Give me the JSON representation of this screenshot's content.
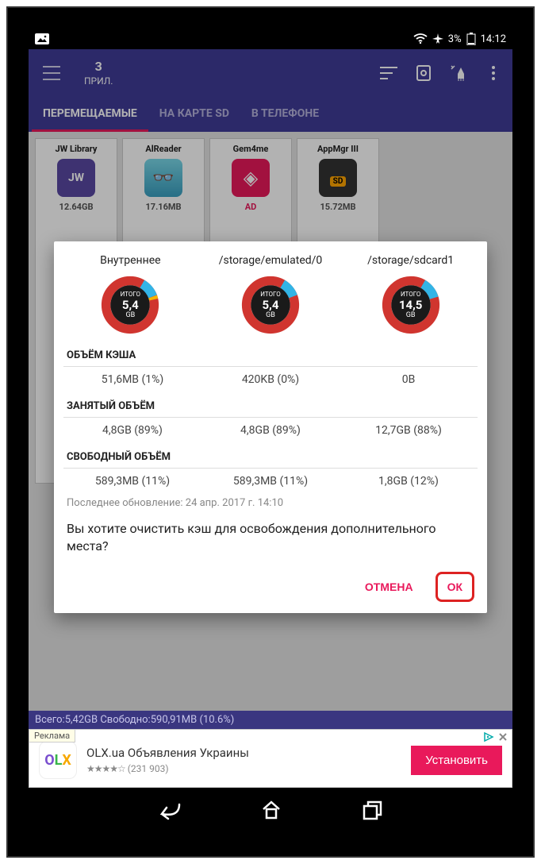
{
  "status": {
    "battery": "3%",
    "time": "14:12"
  },
  "header": {
    "count": "3",
    "count_label": "ПРИЛ."
  },
  "tabs": {
    "movable": "ПЕРЕМЕЩАЕМЫЕ",
    "onsd": "НА КАРТЕ SD",
    "phone": "В ТЕЛЕФОНЕ"
  },
  "apps": [
    {
      "name": "JW Library",
      "size": "12.64GB",
      "icon_bg": "#5A48A3",
      "icon_text": "JW"
    },
    {
      "name": "AlReader",
      "size": "17.16MB",
      "icon_bg": "#6ed0e0",
      "icon_text": "👓"
    },
    {
      "name": "Gem4me",
      "size": "AD",
      "icon_bg": "#E9195B",
      "icon_text": "◇",
      "is_ad": true
    },
    {
      "name": "AppMgr III",
      "size": "15.72MB",
      "icon_bg": "#333",
      "icon_text": "SD"
    }
  ],
  "dialog": {
    "cols": [
      {
        "label": "Внутреннее",
        "total_label": "ИТОГО",
        "value": "5,4",
        "unit": "GB"
      },
      {
        "label": "/storage/emulated/0",
        "total_label": "ИТОГО",
        "value": "5,4",
        "unit": "GB"
      },
      {
        "label": "/storage/sdcard1",
        "total_label": "ИТОГО",
        "value": "14,5",
        "unit": "GB"
      }
    ],
    "sections": {
      "cache": {
        "title": "ОБЪЁМ КЭША",
        "v1": "51,6MB (1%)",
        "v2": "420KB (0%)",
        "v3": "0B"
      },
      "used": {
        "title": "ЗАНЯТЫЙ ОБЪЁМ",
        "v1": "4,8GB (89%)",
        "v2": "4,8GB (89%)",
        "v3": "12,7GB (88%)"
      },
      "free": {
        "title": "СВОБОДНЫЙ ОБЪЁМ",
        "v1": "589,3MB (11%)",
        "v2": "589,3MB (11%)",
        "v3": "1,8GB (12%)"
      }
    },
    "updated": "Последнее обновление: 24 апр. 2017 г. 14:10",
    "question": "Вы хотите очистить кэш для освобождения дополнительного места?",
    "cancel": "ОТМЕНА",
    "ok": "ОК"
  },
  "stats": "Всего:5,42GB Свободно:590,91MB (10.6%)",
  "ad": {
    "tag": "Реклама",
    "brand_o": "O",
    "brand_l": "L",
    "brand_x": "X",
    "title": "OLX.ua Объявления Украины",
    "rating": "★★★★☆",
    "reviews": "(231 903)",
    "install": "Установить"
  }
}
